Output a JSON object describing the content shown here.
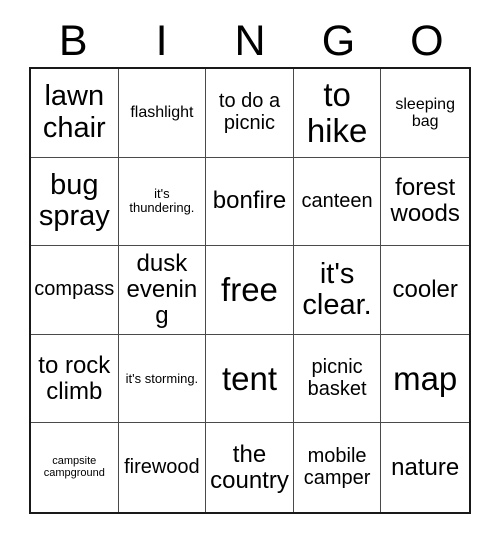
{
  "header": {
    "letters": [
      "B",
      "I",
      "N",
      "G",
      "O"
    ]
  },
  "grid": {
    "rows": 5,
    "columns": 5,
    "border_color": "#191919",
    "grid_line_color": "#4a4a4a",
    "background_color": "#ffffff",
    "text_color": "#000000",
    "cells": [
      {
        "text": "lawn chair",
        "size": "s-xl"
      },
      {
        "text": "flashlight",
        "size": "s-sm"
      },
      {
        "text": "to do a picnic",
        "size": "s-md"
      },
      {
        "text": "to hike",
        "size": "s-xxl"
      },
      {
        "text": "sleeping bag",
        "size": "s-sm"
      },
      {
        "text": "bug spray",
        "size": "s-xl"
      },
      {
        "text": "it's thundering.",
        "size": "s-xs"
      },
      {
        "text": "bonfire",
        "size": "s-lg"
      },
      {
        "text": "canteen",
        "size": "s-md"
      },
      {
        "text": "forest woods",
        "size": "s-lg"
      },
      {
        "text": "compass",
        "size": "s-md"
      },
      {
        "text": "dusk evening",
        "size": "s-lg"
      },
      {
        "text": "free",
        "size": "s-xxl"
      },
      {
        "text": "it's clear.",
        "size": "s-xl"
      },
      {
        "text": "cooler",
        "size": "s-lg"
      },
      {
        "text": "to rock climb",
        "size": "s-lg"
      },
      {
        "text": "it's storming.",
        "size": "s-xs"
      },
      {
        "text": "tent",
        "size": "s-xxl"
      },
      {
        "text": "picnic basket",
        "size": "s-md"
      },
      {
        "text": "map",
        "size": "s-xxl"
      },
      {
        "text": "campsite campground",
        "size": "s-xxs"
      },
      {
        "text": "firewood",
        "size": "s-md"
      },
      {
        "text": "the country",
        "size": "s-lg"
      },
      {
        "text": "mobile camper",
        "size": "s-md"
      },
      {
        "text": "nature",
        "size": "s-lg"
      }
    ]
  }
}
